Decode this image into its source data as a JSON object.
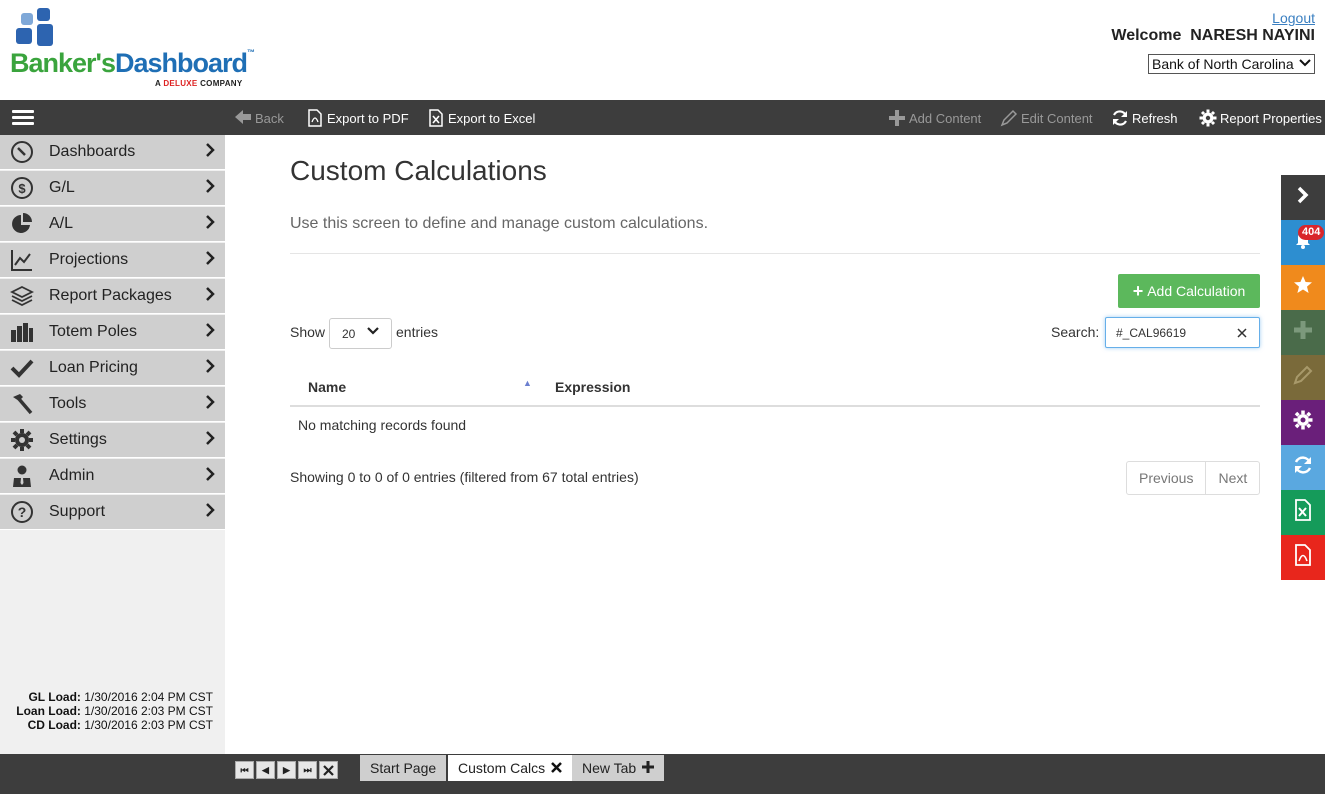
{
  "header": {
    "logo_brand_1": "Banker's",
    "logo_brand_2": "Dashboard",
    "logo_tm": "™",
    "logo_sub_prefix": "A",
    "logo_sub_brand": "DELUXE",
    "logo_sub_suffix": "COMPANY",
    "logout": "Logout",
    "welcome": "Welcome  NARESH NAYINI",
    "bank": "Bank of North Carolina"
  },
  "toolbar": {
    "back": "Back",
    "export_pdf": "Export to PDF",
    "export_excel": "Export to Excel",
    "add_content": "Add Content",
    "edit_content": "Edit Content",
    "refresh": "Refresh",
    "report_properties": "Report Properties"
  },
  "sidebar": {
    "items": [
      {
        "label": "Dashboards",
        "icon": "compass-icon"
      },
      {
        "label": "G/L",
        "icon": "dollar-icon"
      },
      {
        "label": "A/L",
        "icon": "pie-icon"
      },
      {
        "label": "Projections",
        "icon": "line-chart-icon"
      },
      {
        "label": "Report Packages",
        "icon": "layers-icon"
      },
      {
        "label": "Totem Poles",
        "icon": "bar-chart-icon"
      },
      {
        "label": "Loan Pricing",
        "icon": "check-icon"
      },
      {
        "label": "Tools",
        "icon": "hammer-icon"
      },
      {
        "label": "Settings",
        "icon": "gear-icon"
      },
      {
        "label": "Admin",
        "icon": "user-tie-icon"
      },
      {
        "label": "Support",
        "icon": "question-icon"
      }
    ],
    "load": {
      "gl_label": "GL Load:",
      "gl_value": "1/30/2016 2:04 PM CST",
      "loan_label": "Loan Load:",
      "loan_value": "1/30/2016 2:03 PM CST",
      "cd_label": "CD Load:",
      "cd_value": "1/30/2016 2:03 PM CST"
    }
  },
  "main": {
    "title": "Custom Calculations",
    "description": "Use this screen to define and manage custom calculations.",
    "add_button": "Add Calculation",
    "show_label": "Show",
    "entries_value": "20",
    "entries_label": "entries",
    "search_label": "Search:",
    "search_value": "#_CAL96619",
    "columns": [
      "Name",
      "Expression"
    ],
    "empty_message": "No matching records found",
    "showing": "Showing 0 to 0 of 0 entries (filtered from 67 total entries)",
    "previous": "Previous",
    "next": "Next"
  },
  "rightbar": {
    "notification_count": "404",
    "colors": [
      "#3d3d3d",
      "#2d8ed0",
      "#f08a1c",
      "#4a6b4a",
      "#7a6a3a",
      "#6a1f7a",
      "#5aa8e0",
      "#159b5a",
      "#e8261c"
    ]
  },
  "bottombar": {
    "tabs": [
      "Start Page",
      "Custom Calcs",
      "New Tab"
    ]
  }
}
